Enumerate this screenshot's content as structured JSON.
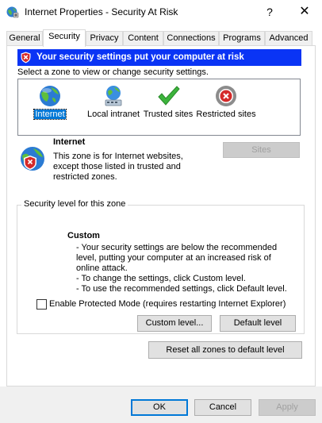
{
  "window": {
    "title": "Internet Properties - Security At Risk",
    "help_glyph": "?",
    "close_glyph": "✕"
  },
  "tabs": [
    {
      "label": "General"
    },
    {
      "label": "Security"
    },
    {
      "label": "Privacy"
    },
    {
      "label": "Content"
    },
    {
      "label": "Connections"
    },
    {
      "label": "Programs"
    },
    {
      "label": "Advanced"
    }
  ],
  "warning_banner": {
    "text": "Your security settings put your computer at risk",
    "icon": "shield-x-icon",
    "color": "#0a34f5"
  },
  "zones": {
    "prompt": "Select a zone to view or change security settings.",
    "items": [
      {
        "label": "Internet",
        "icon": "globe-icon",
        "selected": true
      },
      {
        "label": "Local intranet",
        "icon": "intranet-icon",
        "selected": false
      },
      {
        "label": "Trusted sites",
        "icon": "checkmark-icon",
        "selected": false
      },
      {
        "label": "Restricted sites",
        "icon": "restricted-icon",
        "selected": false
      }
    ]
  },
  "zone_info": {
    "name": "Internet",
    "description": "This zone is for Internet websites, except those listed in trusted and restricted zones.",
    "sites_button": "Sites"
  },
  "security_level": {
    "group_title": "Security level for this zone",
    "level_name": "Custom",
    "lines": [
      "- Your security settings are below the recommended",
      "level, putting your computer at an increased risk of",
      "online attack.",
      "- To change the settings, click Custom level.",
      "- To use the recommended settings, click Default level."
    ],
    "protected_mode_label": "Enable Protected Mode (requires restarting Internet Explorer)",
    "protected_mode_checked": false,
    "custom_level_button": "Custom level...",
    "default_level_button": "Default level"
  },
  "reset_button": "Reset all zones to default level",
  "footer": {
    "ok": "OK",
    "cancel": "Cancel",
    "apply": "Apply"
  }
}
